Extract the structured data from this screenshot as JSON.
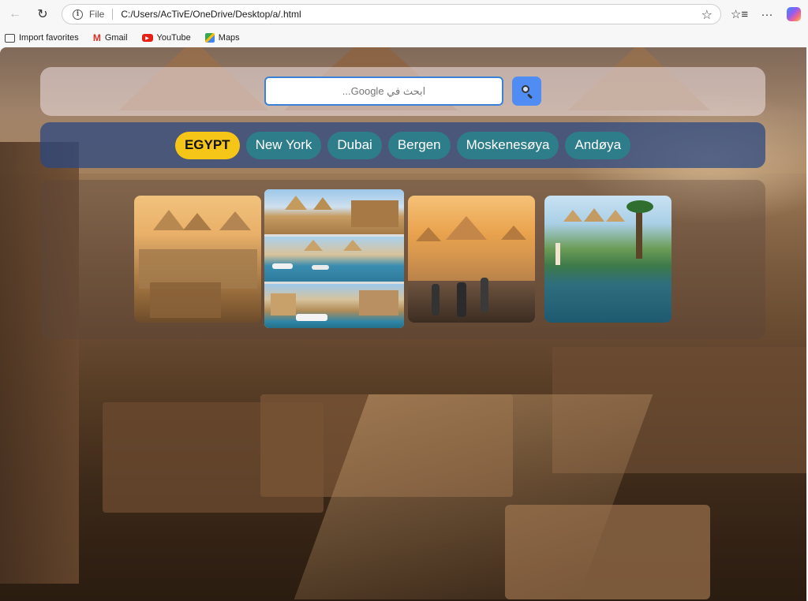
{
  "browser": {
    "address": {
      "scheme_label": "File",
      "url": "C:/Users/AcTivE/OneDrive/Desktop/a/.html"
    },
    "bookmarks": [
      {
        "label": "Import favorites",
        "icon": "import-icon"
      },
      {
        "label": "Gmail",
        "icon": "gmail-icon"
      },
      {
        "label": "YouTube",
        "icon": "youtube-icon"
      },
      {
        "label": "Maps",
        "icon": "maps-icon"
      }
    ]
  },
  "search": {
    "placeholder": "ابحث في Google...",
    "value": ""
  },
  "tabs": [
    {
      "label": "EGYPT",
      "active": true
    },
    {
      "label": "New York",
      "active": false
    },
    {
      "label": "Dubai",
      "active": false
    },
    {
      "label": "Bergen",
      "active": false
    },
    {
      "label": "Moskenesøya",
      "active": false
    },
    {
      "label": "Andøya",
      "active": false
    }
  ],
  "colors": {
    "active_tab": "#f5c518",
    "tab": "#2d7d8a",
    "search_button": "#4f8df5",
    "search_border": "#3b82d6"
  }
}
